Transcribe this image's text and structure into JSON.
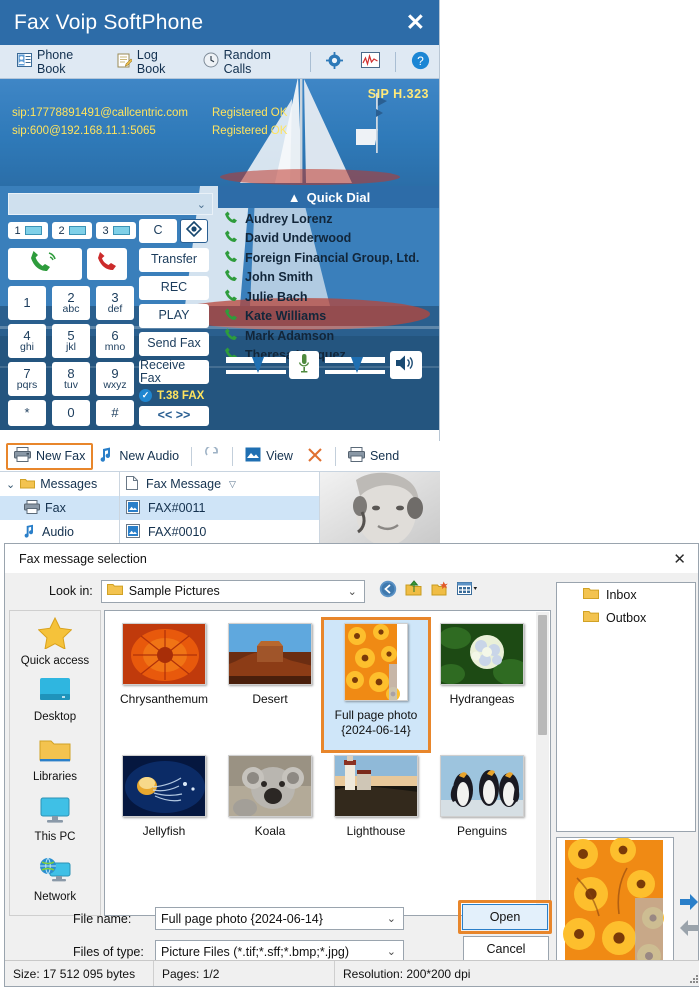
{
  "softphone": {
    "title": "Fax Voip SoftPhone",
    "close_label": "✕",
    "tabs": [
      {
        "label": "Phone Book",
        "icon": "contacts-icon"
      },
      {
        "label": "Log Book",
        "icon": "notepad-icon"
      },
      {
        "label": "Random Calls",
        "icon": "clock-icon"
      }
    ],
    "tool_icons": [
      {
        "name": "settings-gear-icon"
      },
      {
        "name": "statistics-chart-icon"
      },
      {
        "name": "help-question-icon"
      }
    ],
    "banner": {
      "protocol_label": "SIP  H.323",
      "accounts": [
        {
          "uri": "sip:17778891491@callcentric.com",
          "status": "Registered OK"
        },
        {
          "uri": "sip:600@192.168.11.1:5065",
          "status": "Registered OK"
        }
      ]
    },
    "dial_input": {
      "value": "",
      "placeholder": ""
    },
    "quick_dial": {
      "header": "Quick Dial",
      "collapse_icon": "▲",
      "contacts": [
        "Audrey Lorenz",
        "David Underwood",
        "Foreign Financial Group, Ltd.",
        "John Smith",
        "Julie Bach",
        "Kate Williams",
        "Mark Adamson",
        "Theresa Vazquez"
      ]
    },
    "lines": [
      "1",
      "2",
      "3"
    ],
    "keypad": [
      {
        "num": "1",
        "sub": ""
      },
      {
        "num": "2",
        "sub": "abc"
      },
      {
        "num": "3",
        "sub": "def"
      },
      {
        "num": "4",
        "sub": "ghi"
      },
      {
        "num": "5",
        "sub": "jkl"
      },
      {
        "num": "6",
        "sub": "mno"
      },
      {
        "num": "7",
        "sub": "pqrs"
      },
      {
        "num": "8",
        "sub": "tuv"
      },
      {
        "num": "9",
        "sub": "wxyz"
      },
      {
        "num": "*",
        "sub": ""
      },
      {
        "num": "0",
        "sub": ""
      },
      {
        "num": "#",
        "sub": ""
      }
    ],
    "side_buttons": [
      "Transfer",
      "REC",
      "PLAY",
      "Send Fax",
      "Receive Fax"
    ],
    "clear_button": "C",
    "t38": {
      "label": "T.38 FAX",
      "checked": true
    },
    "expand_button": "<< >>",
    "toolbar": [
      {
        "label": "New Fax",
        "icon": "fax-printer-icon",
        "highlighted": true
      },
      {
        "label": "New Audio",
        "icon": "music-note-icon",
        "highlighted": false
      },
      {
        "label": "",
        "icon": "refresh-icon",
        "highlighted": false
      },
      {
        "label": "View",
        "icon": "view-image-icon",
        "highlighted": false
      },
      {
        "label": "",
        "icon": "delete-x-icon",
        "highlighted": false
      },
      {
        "label": "Send",
        "icon": "send-fax-icon",
        "highlighted": false
      }
    ],
    "tree": [
      {
        "label": "Messages",
        "icon": "folder-icon",
        "level": 0,
        "selected": false,
        "expander": "⌄"
      },
      {
        "label": "Fax",
        "icon": "fax-printer-icon",
        "level": 1,
        "selected": true,
        "expander": ""
      },
      {
        "label": "Audio",
        "icon": "music-note-icon",
        "level": 1,
        "selected": false,
        "expander": ""
      }
    ],
    "message_list": {
      "column_header": "Fax Message",
      "sort_icon": "▽",
      "rows": [
        {
          "name": "FAX#0011",
          "selected": true
        },
        {
          "name": "FAX#0010",
          "selected": false
        }
      ]
    }
  },
  "dialog": {
    "title": "Fax message selection",
    "close_label": "✕",
    "lookin_label": "Look in:",
    "lookin_value": "Sample Pictures",
    "nav_icons": [
      {
        "name": "back-arrow-icon"
      },
      {
        "name": "up-folder-icon"
      },
      {
        "name": "new-folder-icon"
      },
      {
        "name": "view-mode-icon"
      }
    ],
    "places": [
      {
        "label": "Quick access",
        "icon": "star-icon"
      },
      {
        "label": "Desktop",
        "icon": "desktop-icon"
      },
      {
        "label": "Libraries",
        "icon": "folder-icon"
      },
      {
        "label": "This PC",
        "icon": "monitor-icon"
      },
      {
        "label": "Network",
        "icon": "network-globe-icon"
      }
    ],
    "files": [
      {
        "name": "Chrysanthemum",
        "selected": false,
        "orientation": "landscape"
      },
      {
        "name": "Desert",
        "selected": false,
        "orientation": "landscape"
      },
      {
        "name": "Full page photo {2024-06-14}",
        "selected": true,
        "orientation": "portrait"
      },
      {
        "name": "Hydrangeas",
        "selected": false,
        "orientation": "landscape"
      },
      {
        "name": "Jellyfish",
        "selected": false,
        "orientation": "landscape"
      },
      {
        "name": "Koala",
        "selected": false,
        "orientation": "landscape"
      },
      {
        "name": "Lighthouse",
        "selected": false,
        "orientation": "landscape"
      },
      {
        "name": "Penguins",
        "selected": false,
        "orientation": "landscape"
      }
    ],
    "folders": [
      {
        "label": "Inbox",
        "icon": "folder-icon"
      },
      {
        "label": "Outbox",
        "icon": "folder-icon"
      }
    ],
    "filename_label": "File name:",
    "filename_value": "Full page photo {2024-06-14}",
    "filetype_label": "Files of type:",
    "filetype_value": "Picture Files (*.tif;*.sff;*.bmp;*.jpg)",
    "open_button": "Open",
    "cancel_button": "Cancel",
    "preview_nav": [
      {
        "name": "next-page-arrow-icon",
        "enabled": true
      },
      {
        "name": "prev-page-arrow-icon",
        "enabled": false
      }
    ],
    "status": {
      "size": "Size: 17 512 095 bytes",
      "pages": "Pages: 1/2",
      "resolution": "Resolution: 200*200 dpi"
    }
  },
  "colors": {
    "title_blue": "#2d6ca8",
    "highlight_orange": "#e8862b",
    "sip_yellow": "#ffe45e",
    "selection_blue": "#cfe4f7"
  }
}
